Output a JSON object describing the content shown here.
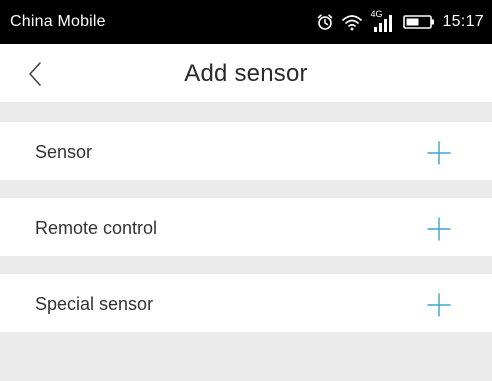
{
  "status_bar": {
    "carrier": "China Mobile",
    "network_label": "4G",
    "time": "15:17",
    "icons": [
      "alarm-icon",
      "wifi-icon",
      "signal-icon",
      "battery-icon"
    ]
  },
  "header": {
    "title": "Add sensor",
    "back_icon": "chevron-left-icon"
  },
  "items": [
    {
      "label": "Sensor",
      "action_icon": "plus-icon"
    },
    {
      "label": "Remote control",
      "action_icon": "plus-icon"
    },
    {
      "label": "Special sensor",
      "action_icon": "plus-icon"
    }
  ],
  "colors": {
    "accent": "#3aa6c8",
    "page_background": "#ebebeb",
    "status_bar": "#000000",
    "text": "#333333"
  }
}
